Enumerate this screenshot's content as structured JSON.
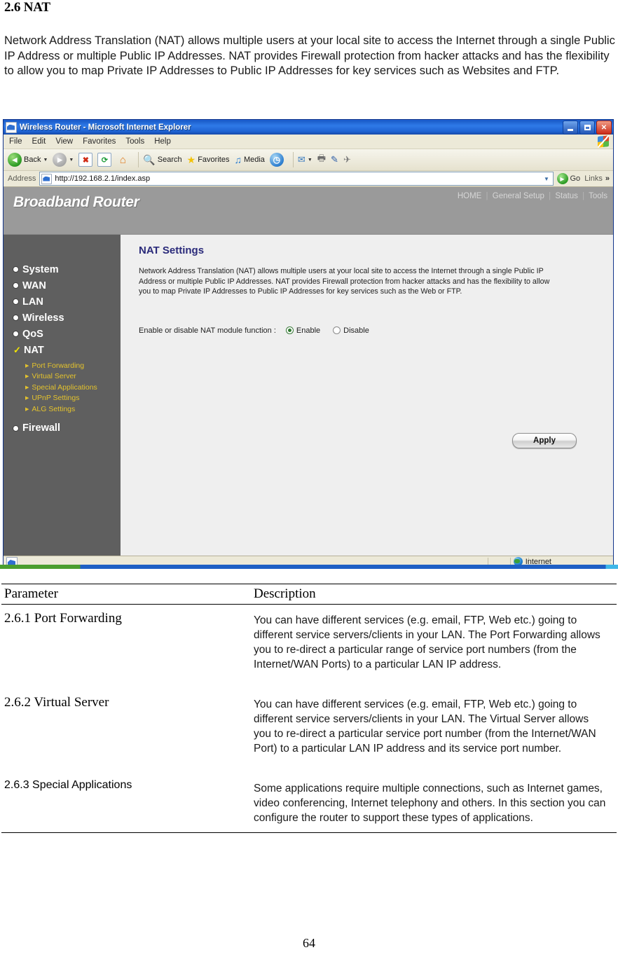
{
  "document": {
    "heading": "2.6 NAT",
    "intro": "Network Address Translation (NAT) allows multiple users at your local site to access the Internet through a single Public IP Address or multiple Public IP Addresses. NAT provides Firewall protection from hacker attacks and has the flexibility to allow you to map Private IP Addresses to Public IP Addresses for key services such as Websites and FTP.",
    "page_number": "64"
  },
  "browser": {
    "title": "Wireless Router - Microsoft Internet Explorer",
    "window_buttons": {
      "minimize": "Minimize",
      "maximize": "Maximize",
      "close": "Close"
    },
    "menu": [
      "File",
      "Edit",
      "View",
      "Favorites",
      "Tools",
      "Help"
    ],
    "toolbar": {
      "back": "Back",
      "forward": "Forward",
      "stop": "Stop",
      "refresh": "Refresh",
      "home": "Home",
      "search": "Search",
      "favorites": "Favorites",
      "media": "Media",
      "history": "History",
      "mail": "Mail",
      "print": "Print",
      "edit": "Edit",
      "discuss": "Discuss"
    },
    "address": {
      "label": "Address",
      "url": "http://192.168.2.1/index.asp",
      "go": "Go",
      "links": "Links",
      "more": "»"
    },
    "statusbar": {
      "zone": "Internet"
    }
  },
  "router": {
    "brand": "Broadband Router",
    "nav": [
      "HOME",
      "General Setup",
      "Status",
      "Tools"
    ],
    "nav_separator": "|",
    "sidebar": [
      {
        "label": "System",
        "type": "bullet"
      },
      {
        "label": "WAN",
        "type": "bullet"
      },
      {
        "label": "LAN",
        "type": "bullet"
      },
      {
        "label": "Wireless",
        "type": "bullet"
      },
      {
        "label": "QoS",
        "type": "bullet"
      },
      {
        "label": "NAT",
        "type": "check"
      }
    ],
    "sidebar_sub": [
      "Port Forwarding",
      "Virtual Server",
      "Special Applications",
      "UPnP Settings",
      "ALG Settings"
    ],
    "sidebar_last": {
      "label": "Firewall",
      "type": "bullet"
    },
    "panel": {
      "title": "NAT Settings",
      "description": "Network Address Translation (NAT) allows multiple users at your local site to access the Internet through a single Public IP Address or multiple Public IP Addresses. NAT provides Firewall protection from hacker attacks and has the flexibility to allow you to map Private IP Addresses to Public IP Addresses for key services such as the Web or FTP.",
      "field_label": "Enable or disable NAT module function :",
      "enable_label": "Enable",
      "disable_label": "Disable",
      "selected": "Enable",
      "apply_label": "Apply"
    },
    "colors": {
      "header_bg": "#9a9a9a",
      "sidebar_bg": "#5f5f5f",
      "main_bg": "#efefef",
      "panel_title": "#2a2a7a",
      "submenu_text": "#e3c22d"
    }
  },
  "table": {
    "headers": {
      "param": "Parameter",
      "desc": "Description"
    },
    "rows": [
      {
        "param": "2.6.1 Port Forwarding",
        "desc": "You can have different services (e.g. email, FTP, Web etc.) going to different service servers/clients in your LAN. The Port Forwarding allows you to re-direct a particular range of service port numbers (from the Internet/WAN Ports) to a particular LAN IP address."
      },
      {
        "param": "2.6.2 Virtual Server",
        "desc": "You can have different services (e.g. email, FTP, Web etc.) going to different service servers/clients in your LAN. The Virtual Server allows you to re-direct a particular service port number (from the Internet/WAN Port) to a particular LAN IP address and its service port number."
      },
      {
        "param": "2.6.3 Special Applications",
        "desc": "Some applications require multiple connections, such as Internet games, video conferencing, Internet telephony and others. In this section you can configure the router to support these types of applications."
      }
    ]
  }
}
